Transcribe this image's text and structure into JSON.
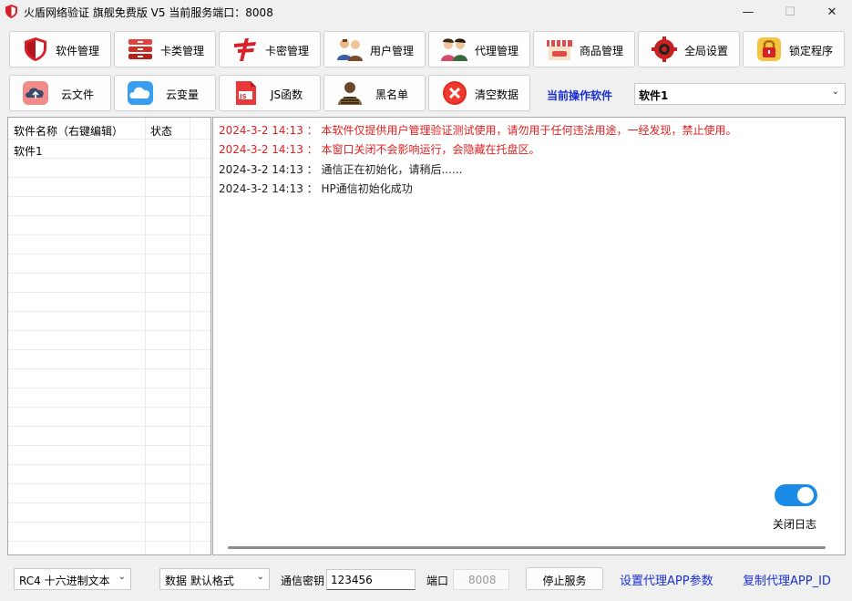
{
  "window": {
    "title": "火盾网络验证 旗舰免费版 V5   当前服务端口：8008",
    "min_glyph": "—",
    "max_glyph": "☐",
    "close_glyph": "✕"
  },
  "toolbar_row1": [
    {
      "label": "软件管理",
      "icon": "shield-icon"
    },
    {
      "label": "卡类管理",
      "icon": "stack-icon"
    },
    {
      "label": "卡密管理",
      "icon": "card-icon"
    },
    {
      "label": "用户管理",
      "icon": "users-icon"
    },
    {
      "label": "代理管理",
      "icon": "agents-icon"
    },
    {
      "label": "商品管理",
      "icon": "shop-icon"
    },
    {
      "label": "全局设置",
      "icon": "gear-icon"
    },
    {
      "label": "锁定程序",
      "icon": "lock-icon"
    }
  ],
  "toolbar_row2": [
    {
      "label": "云文件",
      "icon": "cloud-upload-icon"
    },
    {
      "label": "云变量",
      "icon": "cloud-icon"
    },
    {
      "label": "JS函数",
      "icon": "js-file-icon"
    },
    {
      "label": "黑名单",
      "icon": "blacklist-icon"
    },
    {
      "label": "清空数据",
      "icon": "clear-icon"
    }
  ],
  "current_software": {
    "label": "当前操作软件",
    "value": "软件1"
  },
  "software_list": {
    "col_name": "软件名称（右键编辑）",
    "col_status": "状态",
    "rows": [
      {
        "name": "软件1",
        "status": ""
      }
    ]
  },
  "log": [
    {
      "text": "2024-3-2 14:13 ： 本软件仅提供用户管理验证测试使用，请勿用于任何违法用途，一经发现，禁止使用。",
      "color": "#e02020"
    },
    {
      "text": "2024-3-2 14:13 ： 本窗口关闭不会影响运行，会隐藏在托盘区。",
      "color": "#e02020"
    },
    {
      "text": "2024-3-2 14:13 ： 通信正在初始化，请稍后......",
      "color": "#222222"
    },
    {
      "text": "2024-3-2 14:13 ： HP通信初始化成功",
      "color": "#222222"
    }
  ],
  "toggle": {
    "label": "关闭日志",
    "on": true
  },
  "bottom": {
    "encrypt_mode": "RC4 十六进制文本",
    "data_format": "数据 默认格式",
    "key_label": "通信密钥",
    "key_value": "123456",
    "port_label": "端口",
    "port_value": "8008",
    "stop_button": "停止服务",
    "proxy_params_link": "设置代理APP参数",
    "copy_id_link": "复制代理APP_ID"
  }
}
